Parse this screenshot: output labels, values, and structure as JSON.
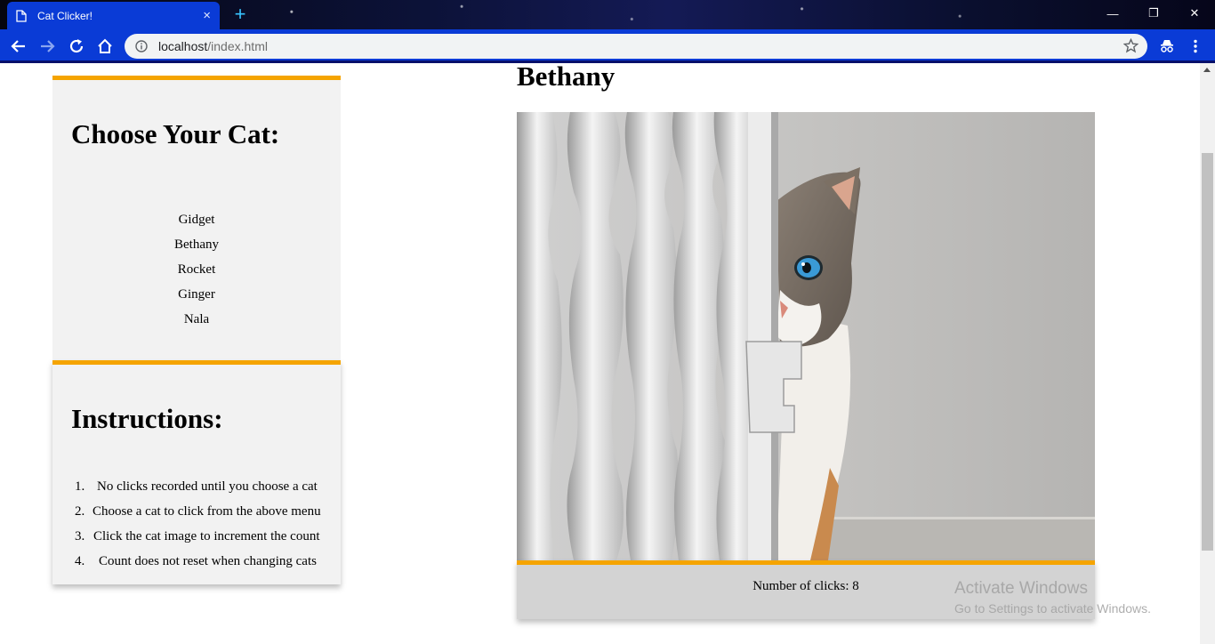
{
  "browser": {
    "tab_title": "Cat Clicker!",
    "tab_close": "×",
    "new_tab": "+",
    "url_host": "localhost",
    "url_path": "/index.html",
    "window_controls": {
      "minimize": "—",
      "restore": "❐",
      "close": "✕"
    }
  },
  "sidebar": {
    "cats_heading": "Choose Your Cat:",
    "cats": [
      "Gidget",
      "Bethany",
      "Rocket",
      "Ginger",
      "Nala"
    ],
    "instructions_heading": "Instructions:",
    "instructions": [
      {
        "num": "1.",
        "text": "No clicks recorded until you choose a cat"
      },
      {
        "num": "2.",
        "text": "Choose a cat to click from the above menu"
      },
      {
        "num": "3.",
        "text": "Click the cat image to increment the count"
      },
      {
        "num": "4.",
        "text": "Count does not reset when changing cats"
      }
    ]
  },
  "main": {
    "selected_cat": "Bethany",
    "clicks_label": "Number of clicks: 8"
  },
  "watermark": {
    "line1": "Activate Windows",
    "line2": "Go to Settings to activate Windows."
  },
  "colors": {
    "accent": "#f5a400",
    "browser_blue": "#0a3bd6"
  }
}
